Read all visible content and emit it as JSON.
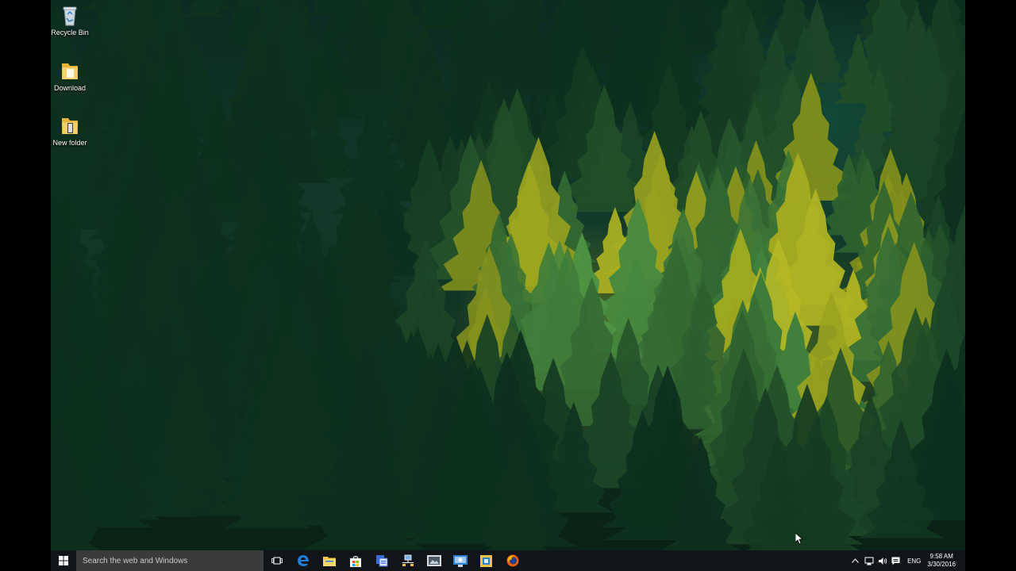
{
  "desktop": {
    "icons": [
      {
        "label": "Recycle Bin",
        "icon": "recycle-bin-icon"
      },
      {
        "label": "Download",
        "icon": "folder-icon"
      },
      {
        "label": "New folder",
        "icon": "folder-icon"
      }
    ]
  },
  "taskbar": {
    "search_placeholder": "Search the web and Windows",
    "pinned": [
      "task-view-icon",
      "edge-icon",
      "file-explorer-icon",
      "store-icon",
      "app-icon",
      "network-app-icon",
      "photos-icon",
      "remote-app-icon",
      "folder-app-icon",
      "firefox-icon"
    ],
    "tray": {
      "language": "ENG",
      "time": "9:58 AM",
      "date": "3/30/2016"
    }
  },
  "colors": {
    "taskbar": "#111418",
    "search_box": "#3a3b3d",
    "edge_blue": "#1e7bd6",
    "folder_yellow": "#f4c542",
    "firefox_orange": "#e66000"
  }
}
